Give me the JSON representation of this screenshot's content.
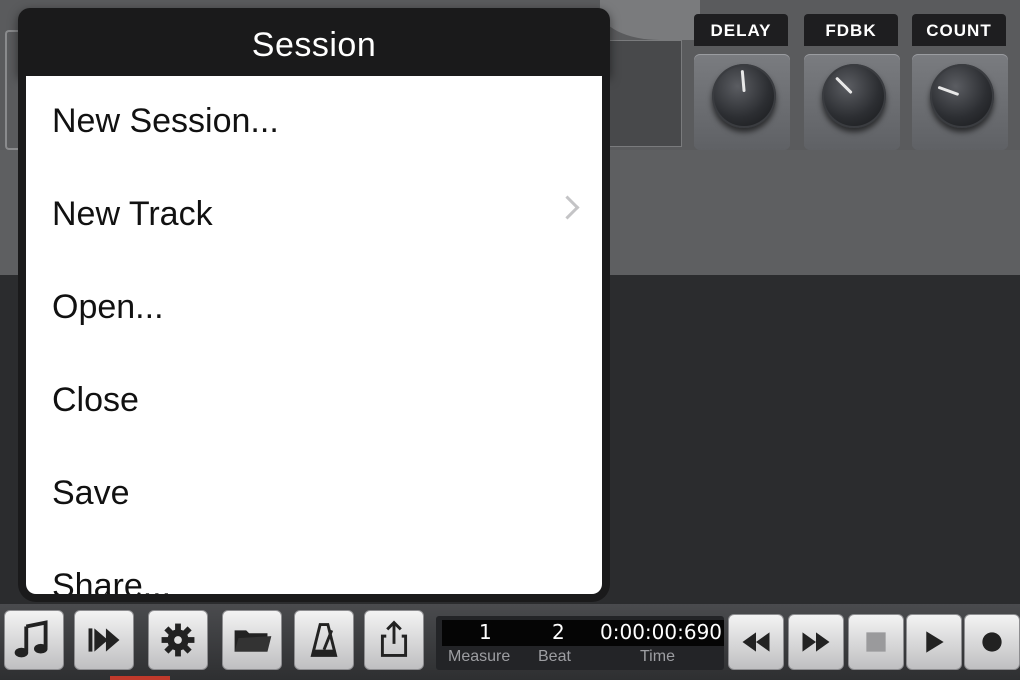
{
  "popover": {
    "title": "Session",
    "items": [
      {
        "label": "New Session...",
        "has_submenu": false
      },
      {
        "label": "New Track",
        "has_submenu": true
      },
      {
        "label": "Open...",
        "has_submenu": false
      },
      {
        "label": "Close",
        "has_submenu": false
      },
      {
        "label": "Save",
        "has_submenu": false
      },
      {
        "label": "Share...",
        "has_submenu": false
      }
    ]
  },
  "knobs": [
    {
      "label": "DELAY"
    },
    {
      "label": "FDBK"
    },
    {
      "label": "COUNT"
    }
  ],
  "toolbar": {
    "buttons": [
      "music-note-icon",
      "fast-forward-track-icon",
      "gear-icon",
      "folder-icon",
      "metronome-icon",
      "share-icon"
    ],
    "counter": {
      "measure_value": "1",
      "beat_value": "2",
      "time_value": "0:00:00:690",
      "measure_label": "Measure",
      "beat_label": "Beat",
      "time_label": "Time"
    },
    "transport": [
      "rewind-icon",
      "fast-forward-icon",
      "stop-icon",
      "play-icon",
      "record-icon"
    ]
  },
  "colors": {
    "popover_header": "#1a1a1b",
    "menu_background": "#ffffff",
    "toolbar_button": "#e6e6e6",
    "background_dark": "#2b2c2e"
  }
}
